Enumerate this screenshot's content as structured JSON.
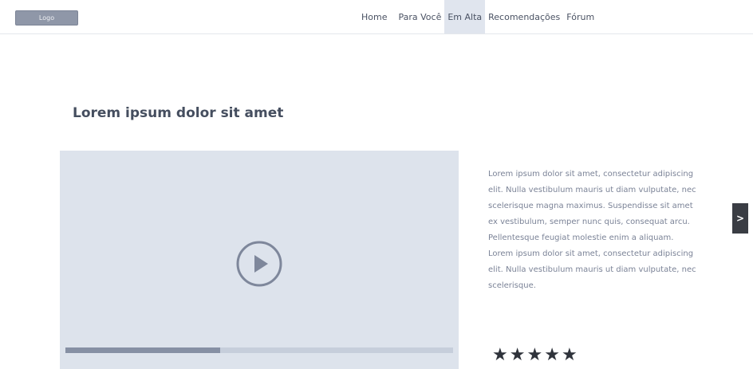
{
  "header": {
    "logo_label": "Logo",
    "nav": [
      {
        "label": "Home",
        "active": false
      },
      {
        "label": "Para Você",
        "active": false
      },
      {
        "label": "Em Alta",
        "active": true
      },
      {
        "label": "Recomendações",
        "active": false
      },
      {
        "label": "Fórum",
        "active": false
      }
    ]
  },
  "main": {
    "title": "Lorem ipsum dolor sit amet",
    "video": {
      "play_icon": "play-circle-icon",
      "progress": 0.4
    },
    "description": [
      "Lorem ipsum dolor sit amet, consectetur adipiscing elit. Nulla vestibulum mauris ut diam vulputate, nec scelerisque magna maximus. Suspendisse sit amet ex vestibulum, semper nunc quis, consequat arcu. Pellentesque feugiat molestie enim a aliquam.",
      "Lorem ipsum dolor sit amet, consectetur adipiscing elit. Nulla vestibulum mauris ut diam vulputate, nec scelerisque."
    ],
    "next_label": ">",
    "rating": {
      "stars": 5,
      "glyph": "★"
    }
  },
  "colors": {
    "active_tab": "#e0e5ee",
    "video_bg": "#dde3ec",
    "progress_fill": "#8690a4",
    "progress_track": "#c6cedb"
  }
}
